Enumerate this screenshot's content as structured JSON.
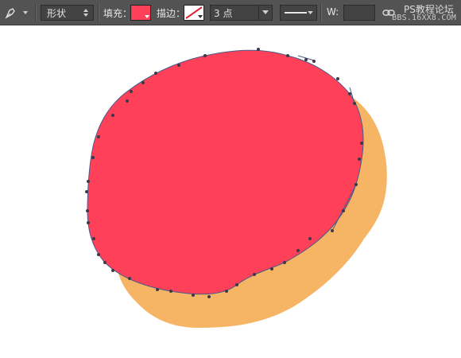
{
  "toolbar": {
    "tool_icon": "pen-tool-icon",
    "mode_value": "形状",
    "fill_label": "填充：",
    "fill_color": "#ff4059",
    "stroke_label": "描边：",
    "stroke_color": "none",
    "stroke_width_value": "3 点",
    "width_label": "W:",
    "width_value": "",
    "link_icon": "link-icon"
  },
  "watermark": {
    "site_name": "PS教程论坛",
    "url": "BBS.16XX8.COM"
  },
  "canvas": {
    "background_color": "#ffffff",
    "back_shape_color": "#f6b565",
    "front_shape_color": "#ff4059",
    "anchor_color": "#3a3a4a"
  }
}
